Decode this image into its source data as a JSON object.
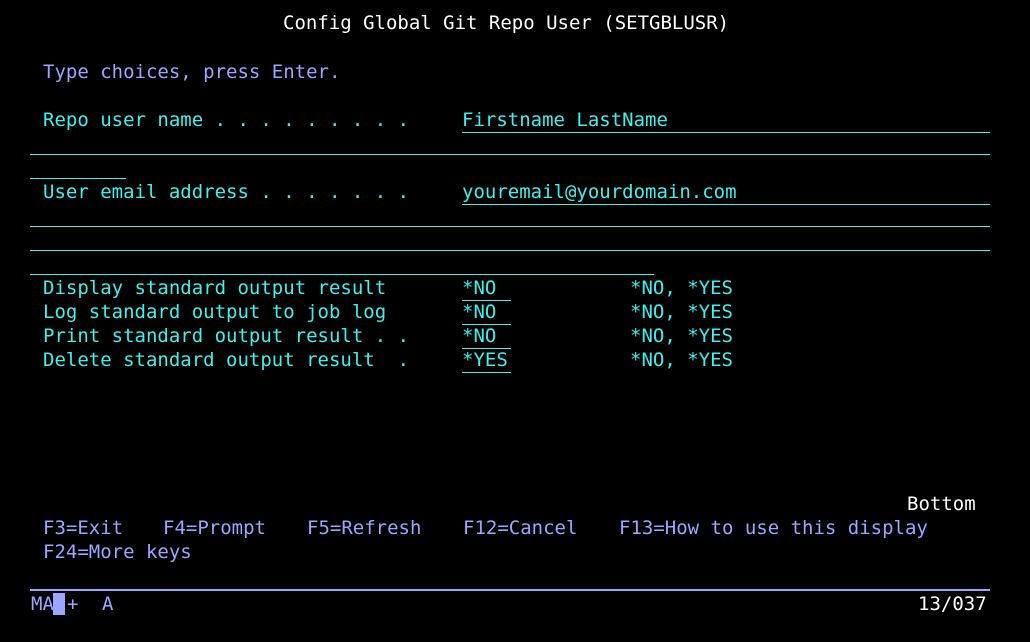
{
  "header": {
    "title": "Config Global Git Repo User (SETGBLUSR)"
  },
  "instructions": "Type choices, press Enter.",
  "fields": {
    "repo_user_name": {
      "label": "Repo user name . . . . . . . . .",
      "value": "Firstname LastName"
    },
    "user_email": {
      "label": "User email address . . . . . . .",
      "value": "youremail@yourdomain.com"
    },
    "display_stdout": {
      "label": "Display standard output result",
      "value": "*NO",
      "choices": "*NO, *YES"
    },
    "log_stdout": {
      "label": "Log standard output to job log",
      "value": "*NO",
      "choices": "*NO, *YES"
    },
    "print_stdout": {
      "label": "Print standard output result . .",
      "value": "*NO",
      "choices": "*NO, *YES"
    },
    "delete_stdout": {
      "label": "Delete standard output result  .",
      "value": "*YES",
      "choices": "*NO, *YES"
    }
  },
  "more_indicator": "Bottom",
  "function_keys": {
    "f3": "F3=Exit",
    "f4": "F4=Prompt",
    "f5": "F5=Refresh",
    "f12": "F12=Cancel",
    "f13": "F13=How to use this display",
    "f24": "F24=More keys"
  },
  "status_bar": {
    "session_left": "MA",
    "session_mid": "+",
    "mode": "A",
    "position": "13/037"
  },
  "colors": {
    "background": "#000000",
    "title": "#ffffff",
    "prompt": "#9aa6ff",
    "field": "#3ff0ec"
  }
}
